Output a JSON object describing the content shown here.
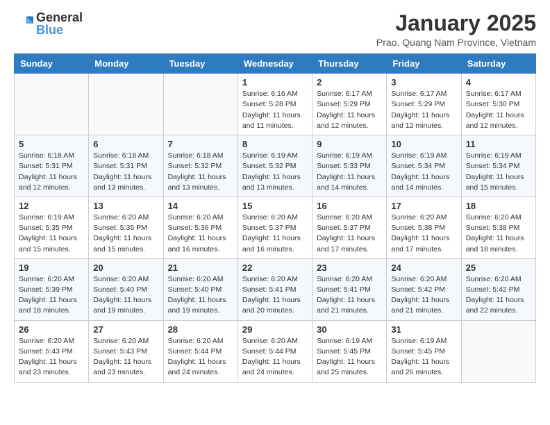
{
  "header": {
    "logo_general": "General",
    "logo_blue": "Blue",
    "month_title": "January 2025",
    "subtitle": "Prao, Quang Nam Province, Vietnam"
  },
  "weekdays": [
    "Sunday",
    "Monday",
    "Tuesday",
    "Wednesday",
    "Thursday",
    "Friday",
    "Saturday"
  ],
  "weeks": [
    [
      {
        "day": "",
        "empty": true
      },
      {
        "day": "",
        "empty": true
      },
      {
        "day": "",
        "empty": true
      },
      {
        "day": "1",
        "sunrise": "6:16 AM",
        "sunset": "5:28 PM",
        "daylight": "11 hours and 11 minutes."
      },
      {
        "day": "2",
        "sunrise": "6:17 AM",
        "sunset": "5:29 PM",
        "daylight": "11 hours and 12 minutes."
      },
      {
        "day": "3",
        "sunrise": "6:17 AM",
        "sunset": "5:29 PM",
        "daylight": "11 hours and 12 minutes."
      },
      {
        "day": "4",
        "sunrise": "6:17 AM",
        "sunset": "5:30 PM",
        "daylight": "11 hours and 12 minutes."
      }
    ],
    [
      {
        "day": "5",
        "sunrise": "6:18 AM",
        "sunset": "5:31 PM",
        "daylight": "11 hours and 12 minutes."
      },
      {
        "day": "6",
        "sunrise": "6:18 AM",
        "sunset": "5:31 PM",
        "daylight": "11 hours and 13 minutes."
      },
      {
        "day": "7",
        "sunrise": "6:18 AM",
        "sunset": "5:32 PM",
        "daylight": "11 hours and 13 minutes."
      },
      {
        "day": "8",
        "sunrise": "6:19 AM",
        "sunset": "5:32 PM",
        "daylight": "11 hours and 13 minutes."
      },
      {
        "day": "9",
        "sunrise": "6:19 AM",
        "sunset": "5:33 PM",
        "daylight": "11 hours and 14 minutes."
      },
      {
        "day": "10",
        "sunrise": "6:19 AM",
        "sunset": "5:34 PM",
        "daylight": "11 hours and 14 minutes."
      },
      {
        "day": "11",
        "sunrise": "6:19 AM",
        "sunset": "5:34 PM",
        "daylight": "11 hours and 15 minutes."
      }
    ],
    [
      {
        "day": "12",
        "sunrise": "6:19 AM",
        "sunset": "5:35 PM",
        "daylight": "11 hours and 15 minutes."
      },
      {
        "day": "13",
        "sunrise": "6:20 AM",
        "sunset": "5:35 PM",
        "daylight": "11 hours and 15 minutes."
      },
      {
        "day": "14",
        "sunrise": "6:20 AM",
        "sunset": "5:36 PM",
        "daylight": "11 hours and 16 minutes."
      },
      {
        "day": "15",
        "sunrise": "6:20 AM",
        "sunset": "5:37 PM",
        "daylight": "11 hours and 16 minutes."
      },
      {
        "day": "16",
        "sunrise": "6:20 AM",
        "sunset": "5:37 PM",
        "daylight": "11 hours and 17 minutes."
      },
      {
        "day": "17",
        "sunrise": "6:20 AM",
        "sunset": "5:38 PM",
        "daylight": "11 hours and 17 minutes."
      },
      {
        "day": "18",
        "sunrise": "6:20 AM",
        "sunset": "5:38 PM",
        "daylight": "11 hours and 18 minutes."
      }
    ],
    [
      {
        "day": "19",
        "sunrise": "6:20 AM",
        "sunset": "5:39 PM",
        "daylight": "11 hours and 18 minutes."
      },
      {
        "day": "20",
        "sunrise": "6:20 AM",
        "sunset": "5:40 PM",
        "daylight": "11 hours and 19 minutes."
      },
      {
        "day": "21",
        "sunrise": "6:20 AM",
        "sunset": "5:40 PM",
        "daylight": "11 hours and 19 minutes."
      },
      {
        "day": "22",
        "sunrise": "6:20 AM",
        "sunset": "5:41 PM",
        "daylight": "11 hours and 20 minutes."
      },
      {
        "day": "23",
        "sunrise": "6:20 AM",
        "sunset": "5:41 PM",
        "daylight": "11 hours and 21 minutes."
      },
      {
        "day": "24",
        "sunrise": "6:20 AM",
        "sunset": "5:42 PM",
        "daylight": "11 hours and 21 minutes."
      },
      {
        "day": "25",
        "sunrise": "6:20 AM",
        "sunset": "5:42 PM",
        "daylight": "11 hours and 22 minutes."
      }
    ],
    [
      {
        "day": "26",
        "sunrise": "6:20 AM",
        "sunset": "5:43 PM",
        "daylight": "11 hours and 23 minutes."
      },
      {
        "day": "27",
        "sunrise": "6:20 AM",
        "sunset": "5:43 PM",
        "daylight": "11 hours and 23 minutes."
      },
      {
        "day": "28",
        "sunrise": "6:20 AM",
        "sunset": "5:44 PM",
        "daylight": "11 hours and 24 minutes."
      },
      {
        "day": "29",
        "sunrise": "6:20 AM",
        "sunset": "5:44 PM",
        "daylight": "11 hours and 24 minutes."
      },
      {
        "day": "30",
        "sunrise": "6:19 AM",
        "sunset": "5:45 PM",
        "daylight": "11 hours and 25 minutes."
      },
      {
        "day": "31",
        "sunrise": "6:19 AM",
        "sunset": "5:45 PM",
        "daylight": "11 hours and 26 minutes."
      },
      {
        "day": "",
        "empty": true
      }
    ]
  ],
  "labels": {
    "sunrise": "Sunrise: ",
    "sunset": "Sunset: ",
    "daylight": "Daylight: "
  }
}
